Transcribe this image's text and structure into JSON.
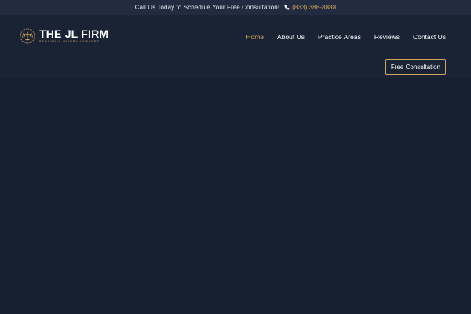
{
  "topbar": {
    "message": "Call Us Today to Schedule Your Free Consultation!",
    "phone": "(833) 388-8888"
  },
  "logo": {
    "title": "THE JL FIRM",
    "subtitle": "PERSONAL INJURY LAWYERS",
    "emblem_icon": "scales-of-justice-icon"
  },
  "nav": {
    "items": [
      {
        "label": "Home",
        "active": true
      },
      {
        "label": "About Us",
        "active": false
      },
      {
        "label": "Practice Areas",
        "active": false
      },
      {
        "label": "Reviews",
        "active": false
      },
      {
        "label": "Contact Us",
        "active": false
      }
    ]
  },
  "cta": {
    "label": "Free Consultation"
  },
  "colors": {
    "accent": "#d2a65a",
    "background": "#161f2f",
    "header": "#1a2334",
    "topbar": "#222c40"
  }
}
